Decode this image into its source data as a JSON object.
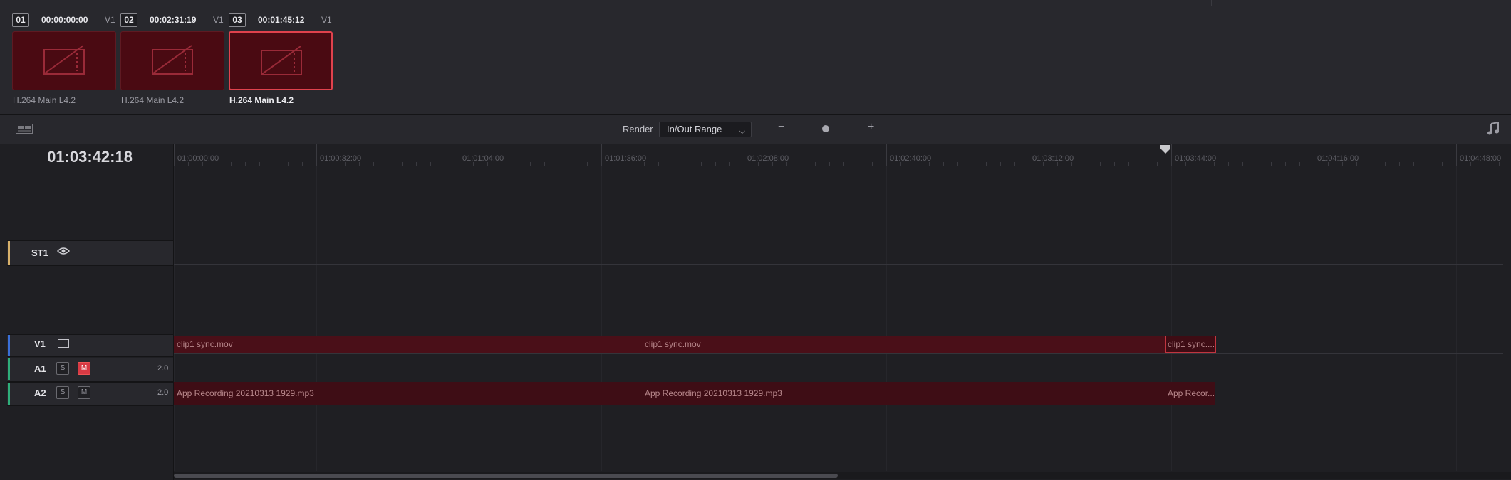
{
  "clips": [
    {
      "num": "01",
      "timecode": "00:00:00:00",
      "track": "V1",
      "codec": "H.264 Main L4.2",
      "selected": false
    },
    {
      "num": "02",
      "timecode": "00:02:31:19",
      "track": "V1",
      "codec": "H.264 Main L4.2",
      "selected": false
    },
    {
      "num": "03",
      "timecode": "00:01:45:12",
      "track": "V1",
      "codec": "H.264 Main L4.2",
      "selected": true
    }
  ],
  "toolbar": {
    "render_label": "Render",
    "render_value": "In/Out Range",
    "zoom_minus": "−",
    "zoom_plus": "+",
    "zoom_level": 0.5
  },
  "timecode": "01:03:42:18",
  "ruler": [
    "01:00:00:00",
    "01:00:32:00",
    "01:01:04:00",
    "01:01:36:00",
    "01:02:08:00",
    "01:02:40:00",
    "01:03:12:00",
    "01:03:44:00",
    "01:04:16:00",
    "01:04:48:00"
  ],
  "tracks": {
    "st1": {
      "label": "ST1"
    },
    "v1": {
      "label": "V1"
    },
    "a1": {
      "label": "A1",
      "solo": "S",
      "mute": "M",
      "channels": "2.0",
      "muted": true
    },
    "a2": {
      "label": "A2",
      "solo": "S",
      "mute": "M",
      "channels": "2.0",
      "muted": false
    }
  },
  "video_clips": [
    "clip1 sync.mov",
    "clip1 sync.mov",
    "clip1 sync...."
  ],
  "audio_clips": [
    "App Recording 20210313 1929.mp3",
    "App Recording 20210313 1929.mp3",
    "App Recor..."
  ],
  "colors": {
    "accent": "#e0424d",
    "clip": "#4a0f18",
    "audio": "#3e0d15",
    "v1": "#3a6fd8",
    "audio_track": "#2fae7a",
    "subtitle": "#d7b06a"
  }
}
